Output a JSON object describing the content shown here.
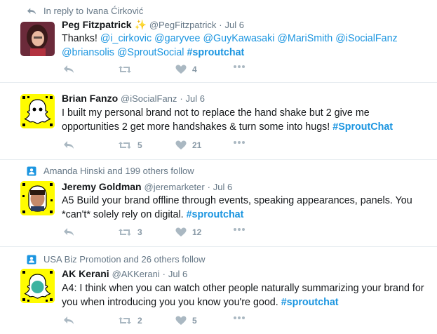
{
  "tweets": [
    {
      "context": "In reply to Ivana Ćirković",
      "context_icon": "reply-arrow-icon",
      "name": "Peg Fitzpatrick",
      "badge": "sparkle-emoji",
      "handle": "@PegFitzpatrick",
      "sep": "·",
      "time": "Jul 6",
      "text_parts": [
        "Thanks! ",
        "@i_cirkovic",
        " ",
        "@garyvee",
        " ",
        "@GuyKawasaki",
        " ",
        "@MariSmith",
        " ",
        "@iSocialFanz",
        " ",
        "@briansolis",
        " ",
        "@SproutSocial",
        " ",
        "#sproutchat"
      ],
      "retweets": "",
      "likes": "4"
    },
    {
      "context": "",
      "name": "Brian Fanzo",
      "handle": "@iSocialFanz",
      "sep": "·",
      "time": "Jul 6",
      "text_parts": [
        "I built my personal brand not to replace the hand shake but 2 give me opportunities 2 get more handshakes & turn some into hugs! ",
        "#SproutChat"
      ],
      "retweets": "5",
      "likes": "21"
    },
    {
      "context": "Amanda Hinski and 199 others follow",
      "context_icon": "person-icon",
      "name": "Jeremy Goldman",
      "handle": "@jeremarketer",
      "sep": "·",
      "time": "Jul 6",
      "text_parts": [
        "A5 Build your brand offline through events, speaking appearances, panels. You *can't* solely rely on digital. ",
        "#sproutchat"
      ],
      "retweets": "3",
      "likes": "12"
    },
    {
      "context": "USA Biz Promotion and 26 others follow",
      "context_icon": "person-icon",
      "name": "AK Kerani",
      "handle": "@AKKerani",
      "sep": "·",
      "time": "Jul 6",
      "text_parts": [
        "A4: I think when you can watch other people naturally summarizing your brand for you when introducing you you know you're good. ",
        "#sproutchat"
      ],
      "retweets": "2",
      "likes": "5"
    }
  ],
  "colors": {
    "link": "#1b95e0",
    "meta": "#657786",
    "action": "#aab8c2",
    "snapcode_yellow": "#fffc00"
  }
}
